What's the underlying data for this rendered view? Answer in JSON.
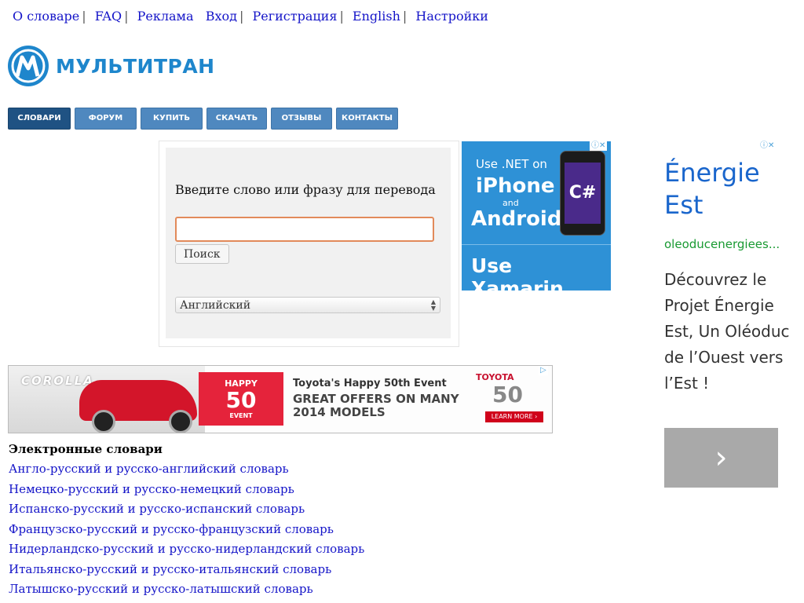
{
  "top_links": [
    {
      "label": "О словаре"
    },
    {
      "label": "FAQ"
    },
    {
      "label": "Реклама"
    },
    {
      "label": "Вход"
    },
    {
      "label": "Регистрация"
    },
    {
      "label": "English"
    },
    {
      "label": "Настройки"
    }
  ],
  "logo": {
    "text": "МУЛЬТИТРАН"
  },
  "nav": [
    {
      "label": "СЛОВАРИ",
      "active": true
    },
    {
      "label": "ФОРУМ"
    },
    {
      "label": "КУПИТЬ"
    },
    {
      "label": "СКАЧАТЬ"
    },
    {
      "label": "ОТЗЫВЫ"
    },
    {
      "label": "КОНТАКТЫ"
    }
  ],
  "search": {
    "prompt": "Введите слово или фразу для перевода",
    "input_value": "",
    "button_label": "Поиск",
    "language_selected": "Английский"
  },
  "ad_xamarin": {
    "line1": "Use .NET on",
    "line2": "iPhone",
    "line3": "and",
    "line4": "Android",
    "screen_text": "C#",
    "cta": "Use Xamarin"
  },
  "ad_right": {
    "title": "Énergie Est",
    "url": "oleoducenergiees...",
    "description": "Découvrez le Projet Énergie Est, Un Oléoduc de l’Ouest vers l’Est !",
    "arrow": "›"
  },
  "ad_toyota": {
    "model": "COROLLA",
    "badge_top": "HAPPY",
    "badge_number": "50",
    "badge_bottom": "EVENT",
    "headline": "Toyota's Happy 50th Event",
    "offer": "GREAT OFFERS ON MANY 2014 MODELS",
    "brand": "TOYOTA",
    "brand_number": "50",
    "cta": "LEARN MORE ›"
  },
  "dictionaries": {
    "heading": "Электронные словари",
    "items": [
      "Англо-русский и русско-английский словарь",
      "Немецко-русский и русско-немецкий словарь",
      "Испанско-русский и русско-испанский словарь",
      "Французско-русский и русско-французский словарь",
      "Нидерландско-русский и русско-нидерландский словарь",
      "Итальянско-русский и русско-итальянский словарь",
      "Латышско-русский и русско-латышский словарь"
    ]
  },
  "colors": {
    "link": "#1414c8",
    "nav_bg": "#4f88bf",
    "nav_active": "#1f5283",
    "logo_blue": "#1e86cc"
  }
}
